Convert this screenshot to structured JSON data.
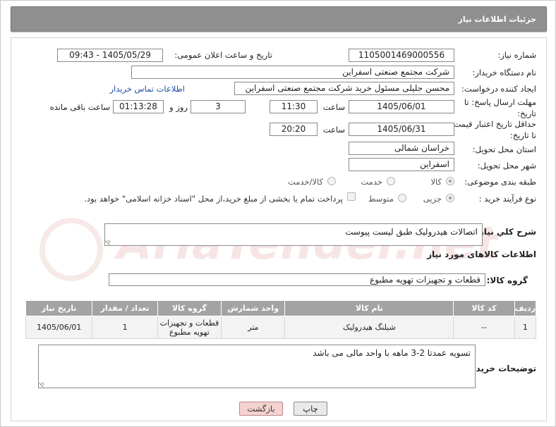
{
  "header": {
    "title": "جزئیات اطلاعات نیاز"
  },
  "form": {
    "need_number_label": "شماره نیاز:",
    "need_number": "1105001469000556",
    "announce_label": "تاریخ و ساعت اعلان عمومی:",
    "announce_value": "1405/05/29 - 09:43",
    "buyer_org_label": "نام دستگاه خریدار:",
    "buyer_org": "شرکت مجتمع صنعتی اسفراین",
    "creator_label": "ایجاد کننده درخواست:",
    "creator": "محسن جلیلی مسئول خرید شرکت مجتمع صنعتی اسفراین",
    "contact_link": "اطلاعات تماس خریدار",
    "deadline_label_1": "مهلت ارسال پاسخ: تا",
    "deadline_label_2": "تاریخ:",
    "deadline_date": "1405/06/01",
    "time_label": "ساعت",
    "deadline_time": "11:30",
    "days": "3",
    "days_label": "روز و",
    "remaining_time": "01:13:28",
    "remaining_label": "ساعت باقی مانده",
    "validity_label_1": "حداقل تاریخ اعتبار قیمت:",
    "validity_label_2": "تا تاریخ:",
    "validity_date": "1405/06/31",
    "validity_time_label": "ساعت",
    "validity_time": "20:20",
    "province_label": "استان محل تحویل:",
    "province": "خراسان شمالی",
    "city_label": "شهر محل تحویل:",
    "city": "اسفراین",
    "category_label": "طبقه بندی موضوعی:",
    "category_options": [
      "کالا",
      "خدمت",
      "کالا/خدمت"
    ],
    "process_label": "نوع فرآیند خرید :",
    "process_options": [
      "جزیی",
      "متوسط"
    ],
    "payment_note": "پرداخت تمام یا بخشی از مبلغ خرید،از محل \"اسناد خزانه اسلامی\" خواهد بود.",
    "description_label": "شرح کلي نياز:",
    "description": "اتصالات هیدرولیک طبق لیست پیوست",
    "items_section_label": "اطلاعات کالاهای مورد نیاز",
    "group_label": "گروه کالا:",
    "group_value": "قطعات و تجهیزات تهویه مطبوع"
  },
  "table": {
    "headers": [
      "ردیف",
      "کد کالا",
      "نام کالا",
      "واحد شمارش",
      "گروه کالا",
      "تعداد / مقدار",
      "تاریخ نیاز"
    ],
    "rows": [
      [
        "1",
        "--",
        "شیلنگ هیدرولیک",
        "متر",
        "قطعات و تجهیزات تهویه مطبوع",
        "1",
        "1405/06/01"
      ]
    ]
  },
  "buyer_notes_label": "توضیحات خریدار:",
  "buyer_notes": "تسویه عمدتا 2-3 ماهه با واحد مالی می باشد",
  "buttons": {
    "print": "چاپ",
    "back": "بازگشت"
  },
  "watermark": "AriaTender.net",
  "colors": {
    "header_bg": "#8f8f8f",
    "table_header_bg": "#a3a3a3",
    "link": "#1a4fa0",
    "back_button_bg": "#f5d2d2"
  }
}
